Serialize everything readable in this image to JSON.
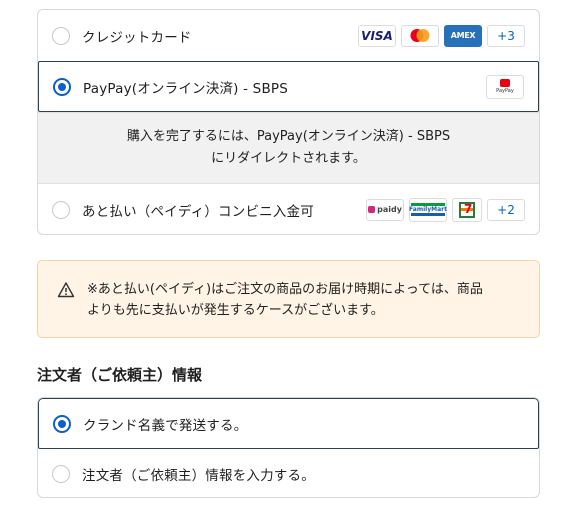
{
  "payment": {
    "options": [
      {
        "label": "クレジットカード",
        "selected": false,
        "logos": [
          "VISA",
          "Mastercard",
          "AMEX"
        ],
        "more": "+3"
      },
      {
        "label": "PayPay(オンライン決済) - SBPS",
        "selected": true,
        "logos": [
          "PayPay"
        ]
      },
      {
        "label": "あと払い（ペイディ）コンビニ入金可",
        "selected": false,
        "logos": [
          "paidy",
          "FamilyMart",
          "7-Eleven"
        ],
        "more": "+2"
      }
    ],
    "info_line1": "購入を完了するには、PayPay(オンライン決済) - SBPS",
    "info_line2": "にリダイレクトされます。",
    "visa_text": "VISA",
    "amex_text": "AMEX",
    "paypay_text": "PayPay",
    "paidy_text": "paidy",
    "familymart_text": "FamilyMart"
  },
  "notice": {
    "line1": "※あと払い(ペイディ)はご注文の商品のお届け時期によっては、商品",
    "line2": "よりも先に支払いが発生するケースがございます。",
    "icon": "warning-triangle-icon"
  },
  "orderer": {
    "title": "注文者（ご依頼主）情報",
    "options": [
      {
        "label": "クランド名義で発送する。",
        "selected": true
      },
      {
        "label": "注文者（ご依頼主）情報を入力する。",
        "selected": false
      }
    ]
  },
  "colors": {
    "accent": "#0a5fc8",
    "selected_border": "#2b3f55",
    "notice_bg": "#fff4e6",
    "info_bg": "#f1f1f1"
  }
}
